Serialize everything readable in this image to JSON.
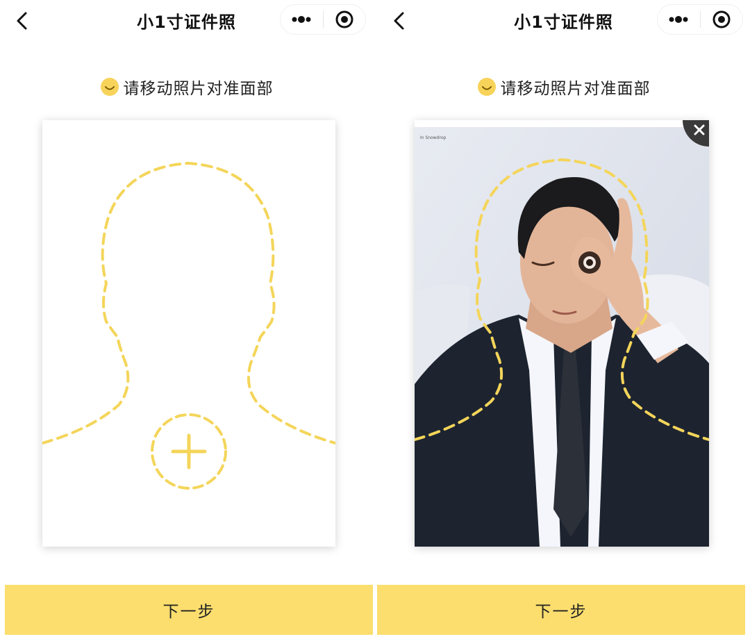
{
  "app": {
    "title": "小1寸证件照"
  },
  "hint": {
    "text": "请移动照片对准面部",
    "icon": "smile-icon"
  },
  "next_button": {
    "label": "下一步"
  },
  "photo": {
    "caption": "In Snowdrop"
  },
  "icons": {
    "back": "chevron-left-icon",
    "more": "more-dots-icon",
    "close_app": "target-circle-icon",
    "add": "plus-icon",
    "remove": "close-icon"
  },
  "colors": {
    "accent": "#fbde6e",
    "outline": "#f4d55a",
    "nav_text": "#111111"
  }
}
